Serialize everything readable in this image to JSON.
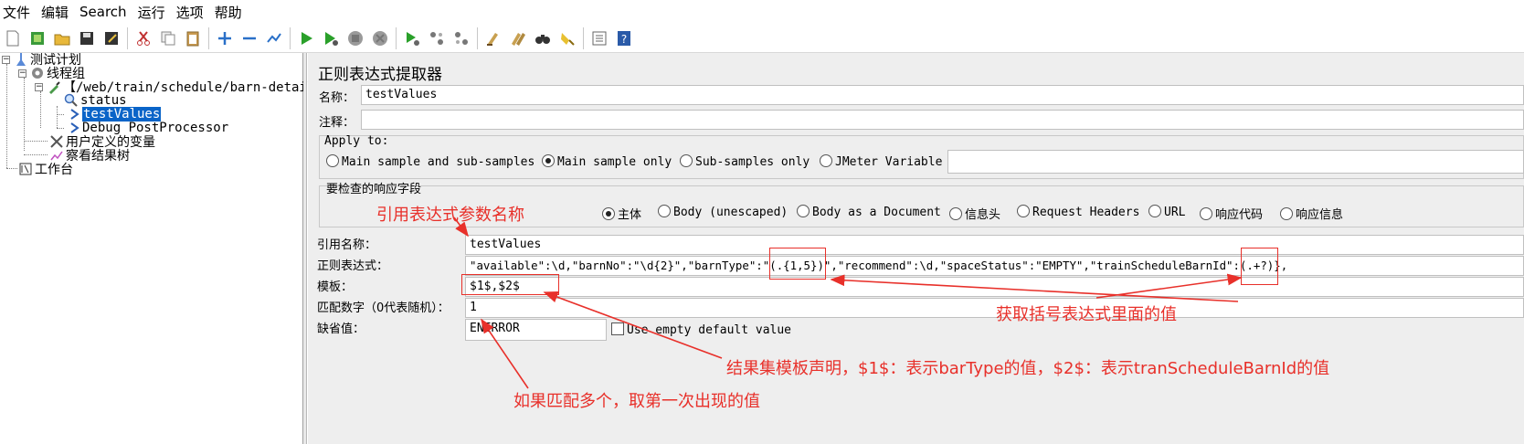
{
  "menu": [
    "文件",
    "编辑",
    "Search",
    "运行",
    "选项",
    "帮助"
  ],
  "toolbar_icons": [
    "new-icon",
    "templates-icon",
    "open-icon",
    "save-icon",
    "save-as-icon",
    "cut-icon",
    "copy-icon",
    "paste-icon",
    "expand-icon",
    "collapse-icon",
    "toggle-icon",
    "start-icon",
    "start-no-pause-icon",
    "stop-icon",
    "shutdown-icon",
    "remote-start-icon",
    "remote-stop-icon",
    "remote-shutdown-icon",
    "clear-icon",
    "clear-all-icon",
    "search-icon",
    "reset-search-icon",
    "function-helper-icon",
    "help-icon"
  ],
  "tree": {
    "test_plan": "测试计划",
    "thread_group": "线程组",
    "sampler": "【/web/train/schedule/barn-detail】",
    "status": "status",
    "test_values": "testValues",
    "debug": "Debug PostProcessor",
    "user_vars": "用户定义的变量",
    "results_tree": "察看结果树",
    "workbench": "工作台"
  },
  "panel": {
    "title": "正则表达式提取器",
    "name_label": "名称：",
    "name_value": "testValues",
    "comment_label": "注释：",
    "comment_value": "",
    "apply_to": {
      "legend": "Apply to:",
      "options": [
        "Main sample and sub-samples",
        "Main sample only",
        "Sub-samples only",
        "JMeter Variable"
      ],
      "selected": 1,
      "variable_value": ""
    },
    "response_field": {
      "legend": "要检查的响应字段",
      "options": [
        "主体",
        "Body (unescaped)",
        "Body as a Document",
        "信息头",
        "Request Headers",
        "URL",
        "响应代码",
        "响应信息"
      ],
      "selected": 0
    },
    "ref_name_label": "引用名称：",
    "ref_name_value": "testValues",
    "regex_label": "正则表达式：",
    "regex_value": "\"available\":\\d,\"barnNo\":\"\\d{2}\",\"barnType\":\"(.{1,5})\",\"recommend\":\\d,\"spaceStatus\":\"EMPTY\",\"trainScheduleBarnId\":(.+?)},",
    "template_label": "模板：",
    "template_value": "$1$,$2$",
    "match_label": "匹配数字（0代表随机）：",
    "match_value": "1",
    "default_label": "缺省值：",
    "default_value": "ENERROR",
    "empty_default_label": "Use empty default value"
  },
  "annotations": {
    "ref_param": "引用表达式参数名称",
    "get_values": "获取括号表达式里面的值",
    "template_decl": "结果集模板声明，$1$：表示barType的值，$2$：表示tranScheduleBarnId的值",
    "first_match": "如果匹配多个，取第一次出现的值"
  },
  "colors": {
    "annotation": "#e8302a",
    "selection": "#0a64c8",
    "panel_bg": "#eeeeee"
  }
}
